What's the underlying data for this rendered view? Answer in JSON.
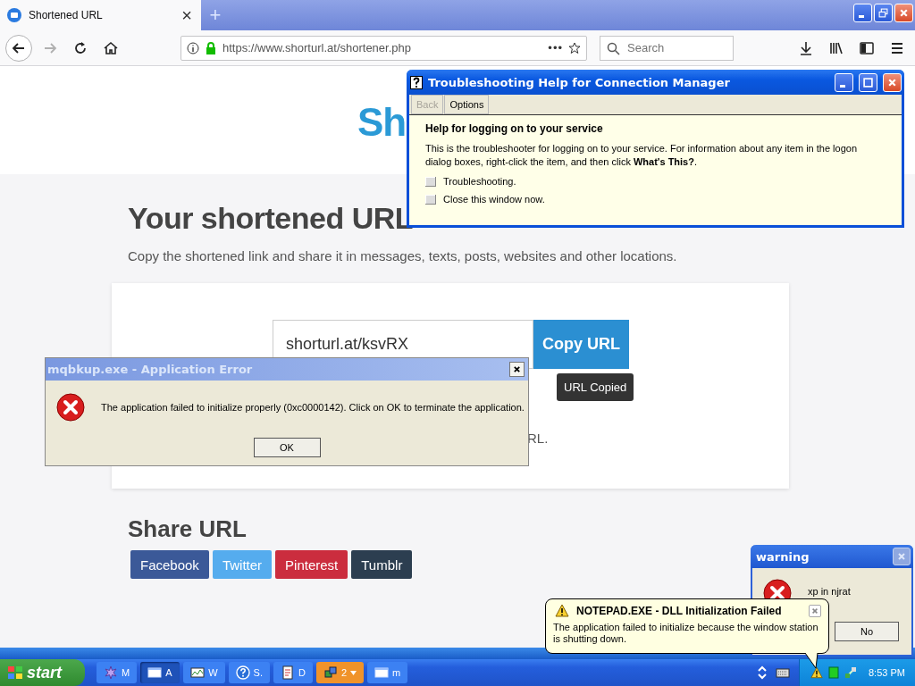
{
  "browser": {
    "tab": {
      "title": "Shortened URL",
      "close": "×"
    },
    "new_tab": "+",
    "forward": {
      "disabled": true
    },
    "address": "https://www.shorturl.at/shortener.php",
    "page_actions": "•••",
    "search": {
      "placeholder": "Search"
    }
  },
  "page": {
    "logo": "Sh",
    "heading": "Your shortened URL",
    "subtitle": "Copy the shortened link and share it in messages, texts, posts, websites and other locations.",
    "short_url": "shorturl.at/ksvRX",
    "copy_button": "Copy URL",
    "tooltip": "URL Copied",
    "note_fragment": "RL.",
    "share": {
      "title": "Share URL",
      "buttons": [
        {
          "label": "Facebook",
          "color": "#3b5998"
        },
        {
          "label": "Twitter",
          "color": "#55acee"
        },
        {
          "label": "Pinterest",
          "color": "#cb2d3e"
        },
        {
          "label": "Tumblr",
          "color": "#2c3e50"
        }
      ]
    }
  },
  "troubleshooter": {
    "title": "Troubleshooting Help for Connection Manager",
    "toolbar": [
      {
        "label": "Back",
        "disabled": true
      },
      {
        "label": "Options",
        "disabled": false
      }
    ],
    "heading": "Help for logging on to your service",
    "body": "This is the troubleshooter for logging on to your service. For information about any item in the logon dialog boxes, right-click the item, and then click **What's This?**.",
    "links": [
      "Troubleshooting.",
      "Close this window now."
    ]
  },
  "error_dialog": {
    "title": "mqbkup.exe - Application Error",
    "message": "The application failed to initialize properly (0xc0000142). Click on OK to terminate the application.",
    "button": "OK"
  },
  "warning_dialog": {
    "title": "warning",
    "message": "xp in njrat",
    "button": "No"
  },
  "balloon": {
    "title": "NOTEPAD.EXE - DLL Initialization Failed",
    "message": "The application failed to initialize because the window station is shutting down."
  },
  "taskbar": {
    "start": "start",
    "tasks": [
      {
        "label": "M",
        "kind": "star",
        "selected": false,
        "flashing": false
      },
      {
        "label": "A",
        "kind": "window",
        "selected": true,
        "flashing": false
      },
      {
        "label": "W",
        "kind": "chart",
        "selected": false,
        "flashing": false
      },
      {
        "label": "S.",
        "kind": "help",
        "selected": false,
        "flashing": false
      },
      {
        "label": "D",
        "kind": "document",
        "selected": false,
        "flashing": false
      },
      {
        "label": "2",
        "kind": "network",
        "selected": false,
        "flashing": true
      },
      {
        "label": "m",
        "kind": "window",
        "selected": false,
        "flashing": false
      }
    ],
    "clock": "8:53 PM"
  }
}
